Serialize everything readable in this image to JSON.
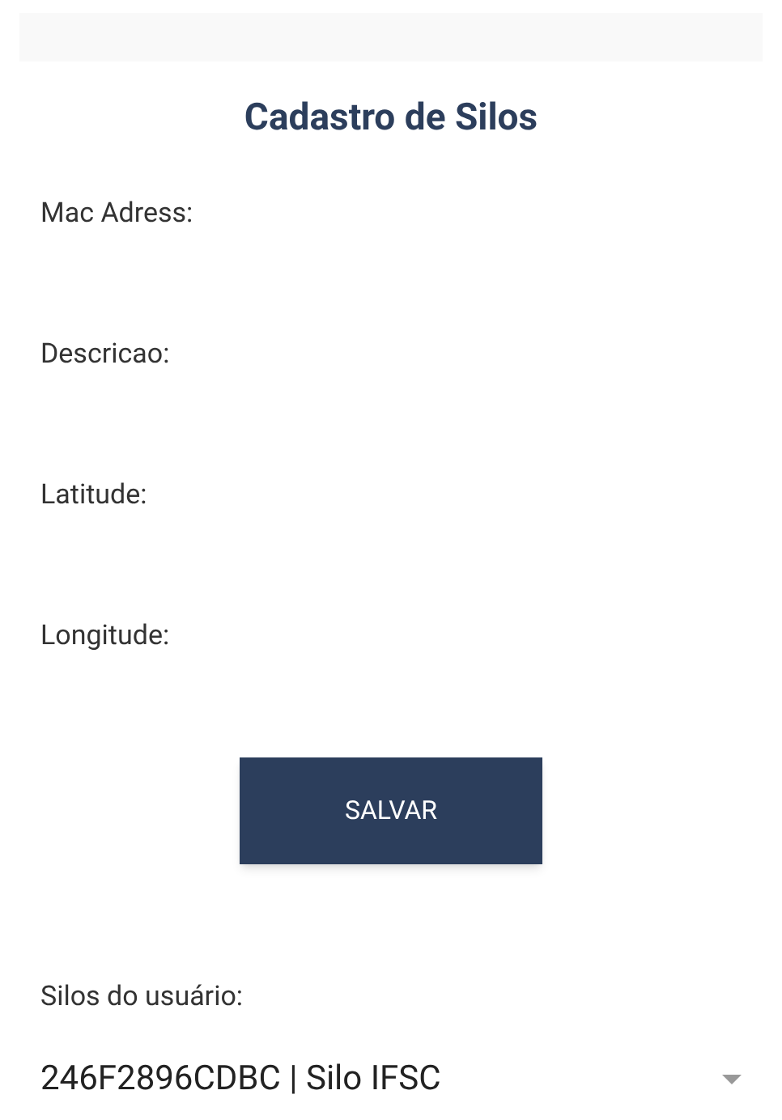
{
  "title": "Cadastro de Silos",
  "fields": [
    {
      "label": "Mac Adress:"
    },
    {
      "label": "Descricao:"
    },
    {
      "label": "Latitude:"
    },
    {
      "label": "Longitude:"
    }
  ],
  "save_button": "SALVAR",
  "silos": {
    "label": "Silos do usuário:",
    "value": "246F2896CDBC | Silo IFSC"
  }
}
